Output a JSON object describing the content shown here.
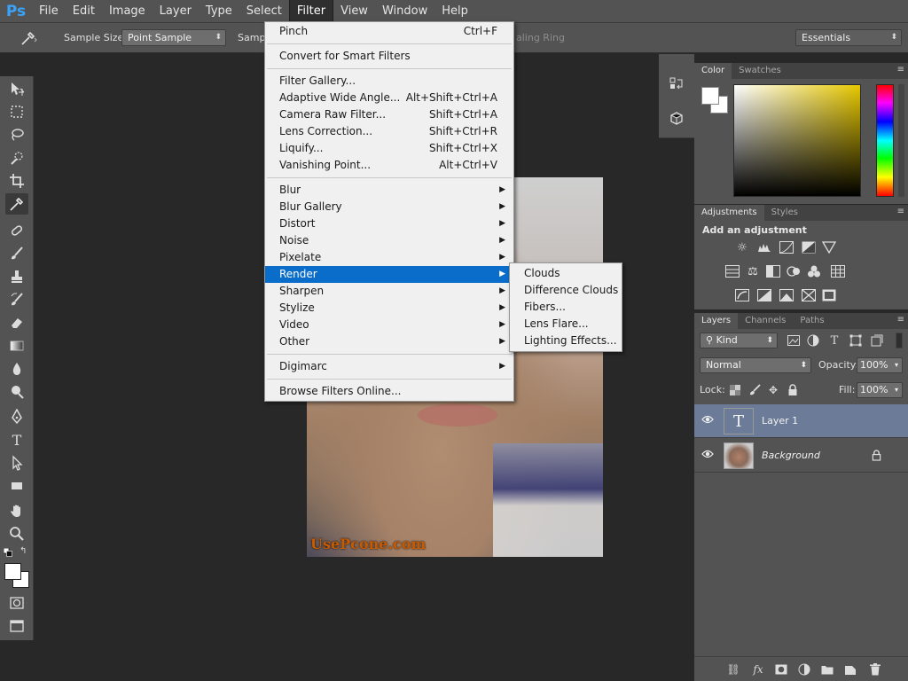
{
  "app": {
    "logo": "Ps",
    "menu": [
      "File",
      "Edit",
      "Image",
      "Layer",
      "Type",
      "Select",
      "Filter",
      "View",
      "Window",
      "Help"
    ],
    "active_menu": "Filter"
  },
  "options_bar": {
    "sample_size_label": "Sample Size:",
    "sample_size_value": "Point Sample",
    "sample_label_partial": "Sampl",
    "sampling_ring_partial": "aling Ring",
    "workspace": "Essentials"
  },
  "filter_menu": {
    "items": [
      {
        "label": "Pinch",
        "shortcut": "Ctrl+F"
      },
      {
        "sep": true
      },
      {
        "label": "Convert for Smart Filters"
      },
      {
        "sep": true
      },
      {
        "label": "Filter Gallery..."
      },
      {
        "label": "Adaptive Wide Angle...",
        "shortcut": "Alt+Shift+Ctrl+A"
      },
      {
        "label": "Camera Raw Filter...",
        "shortcut": "Shift+Ctrl+A"
      },
      {
        "label": "Lens Correction...",
        "shortcut": "Shift+Ctrl+R"
      },
      {
        "label": "Liquify...",
        "shortcut": "Shift+Ctrl+X"
      },
      {
        "label": "Vanishing Point...",
        "shortcut": "Alt+Ctrl+V"
      },
      {
        "sep": true
      },
      {
        "label": "Blur",
        "submenu": true
      },
      {
        "label": "Blur Gallery",
        "submenu": true
      },
      {
        "label": "Distort",
        "submenu": true
      },
      {
        "label": "Noise",
        "submenu": true
      },
      {
        "label": "Pixelate",
        "submenu": true
      },
      {
        "label": "Render",
        "submenu": true,
        "highlighted": true
      },
      {
        "label": "Sharpen",
        "submenu": true
      },
      {
        "label": "Stylize",
        "submenu": true
      },
      {
        "label": "Video",
        "submenu": true
      },
      {
        "label": "Other",
        "submenu": true
      },
      {
        "sep": true
      },
      {
        "label": "Digimarc",
        "submenu": true
      },
      {
        "sep": true
      },
      {
        "label": "Browse Filters Online..."
      }
    ]
  },
  "render_submenu": [
    "Clouds",
    "Difference Clouds",
    "Fibers...",
    "Lens Flare...",
    "Lighting Effects..."
  ],
  "document": {
    "watermark": "UsePcone.com"
  },
  "color_panel": {
    "tabs": [
      "Color",
      "Swatches"
    ]
  },
  "adjustments_panel": {
    "tabs": [
      "Adjustments",
      "Styles"
    ],
    "title": "Add an adjustment"
  },
  "layers_panel": {
    "tabs": [
      "Layers",
      "Channels",
      "Paths"
    ],
    "filter_kind": "Kind",
    "blend_mode": "Normal",
    "opacity_label": "Opacity:",
    "opacity_value": "100%",
    "lock_label": "Lock:",
    "fill_label": "Fill:",
    "fill_value": "100%",
    "layers": [
      {
        "name": "Layer 1",
        "type": "text",
        "selected": true
      },
      {
        "name": "Background",
        "type": "image",
        "locked": true
      }
    ]
  },
  "colors": {
    "menu_highlight": "#0a6dc9",
    "ps_blue": "#38a3f8",
    "panel_bg": "#535353",
    "selected_layer": "#6c7c98"
  }
}
